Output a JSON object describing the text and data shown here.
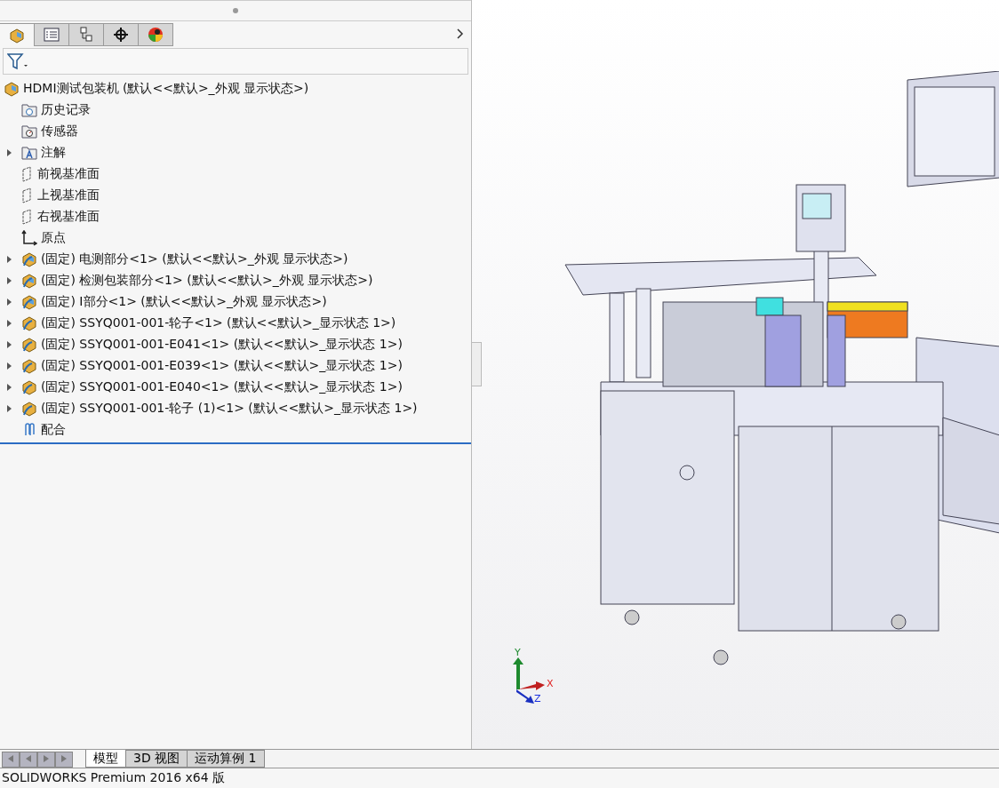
{
  "panel_tabs": [
    {
      "kind": "feature",
      "selected": true
    },
    {
      "kind": "property",
      "selected": false
    },
    {
      "kind": "config",
      "selected": false
    },
    {
      "kind": "dimxpert",
      "selected": false
    },
    {
      "kind": "display",
      "selected": false
    }
  ],
  "tree": {
    "label": "HDMI测试包装机  (默认<<默认>_外观 显示状态>)",
    "kind": "assembly",
    "children": [
      {
        "label": "历史记录",
        "kind": "history",
        "expandable": false
      },
      {
        "label": "传感器",
        "kind": "sensor",
        "expandable": false
      },
      {
        "label": "注解",
        "kind": "annotation",
        "expandable": true
      },
      {
        "label": "前视基准面",
        "kind": "plane",
        "expandable": false
      },
      {
        "label": "上视基准面",
        "kind": "plane",
        "expandable": false
      },
      {
        "label": "右视基准面",
        "kind": "plane",
        "expandable": false
      },
      {
        "label": "原点",
        "kind": "origin",
        "expandable": false
      },
      {
        "label": "(固定) 电测部分<1> (默认<<默认>_外观 显示状态>)",
        "kind": "subassembly",
        "expandable": true
      },
      {
        "label": "(固定) 检测包装部分<1> (默认<<默认>_外观 显示状态>)",
        "kind": "subassembly",
        "expandable": true
      },
      {
        "label": "(固定) I部分<1> (默认<<默认>_外观 显示状态>)",
        "kind": "subassembly",
        "expandable": true
      },
      {
        "label": "(固定) SSYQ001-001-轮子<1> (默认<<默认>_显示状态 1>)",
        "kind": "part",
        "expandable": true
      },
      {
        "label": "(固定) SSYQ001-001-E041<1> (默认<<默认>_显示状态 1>)",
        "kind": "part",
        "expandable": true
      },
      {
        "label": "(固定) SSYQ001-001-E039<1> (默认<<默认>_显示状态 1>)",
        "kind": "part",
        "expandable": true
      },
      {
        "label": "(固定) SSYQ001-001-E040<1> (默认<<默认>_显示状态 1>)",
        "kind": "part",
        "expandable": true
      },
      {
        "label": "(固定) SSYQ001-001-轮子 (1)<1> (默认<<默认>_显示状态 1>)",
        "kind": "part",
        "expandable": true
      },
      {
        "label": "配合",
        "kind": "mates",
        "expandable": false
      }
    ]
  },
  "triad": {
    "x": "X",
    "y": "Y",
    "z": "Z"
  },
  "bottom_tabs": [
    {
      "label": "模型",
      "selected": true
    },
    {
      "label": "3D 视图",
      "selected": false
    },
    {
      "label": "运动算例 1",
      "selected": false
    }
  ],
  "status_bar": "SOLIDWORKS Premium 2016 x64 版"
}
